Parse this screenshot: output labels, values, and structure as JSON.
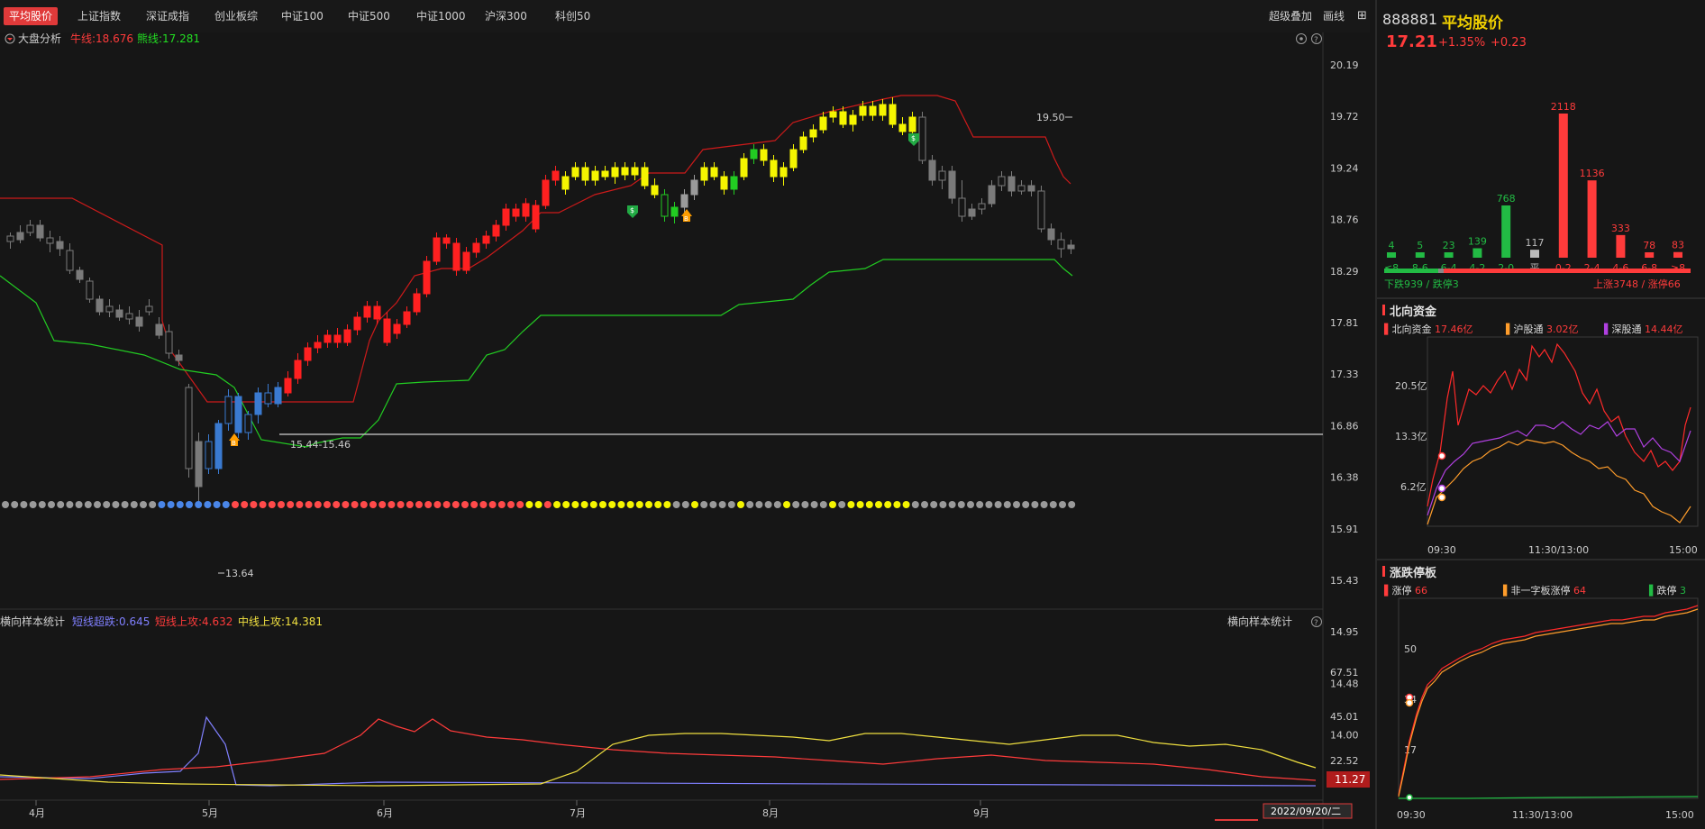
{
  "toolbar": {
    "tabs": [
      "平均股价",
      "上证指数",
      "深证成指",
      "创业板综",
      "中证100",
      "中证500",
      "中证1000",
      "沪深300",
      "科创50"
    ],
    "active_tab": 0,
    "right_actions": [
      "超级叠加",
      "画线"
    ]
  },
  "main_panel": {
    "title": "大盘分析",
    "legend": [
      {
        "label": "牛线:",
        "value": "18.676",
        "color": "#ff3b3b"
      },
      {
        "label": "熊线:",
        "value": "17.281",
        "color": "#22dd22"
      }
    ],
    "price_ticks": [
      "20.19",
      "19.72",
      "19.24",
      "18.76",
      "18.29",
      "17.81",
      "17.33",
      "16.86",
      "16.38",
      "15.91",
      "15.43",
      "14.95",
      "14.48",
      "14.00"
    ],
    "annotations": {
      "high": "19.50",
      "low": "13.64",
      "range": "15.44-15.46"
    },
    "signal_icons": {
      "sell": "$",
      "buy": "B"
    }
  },
  "sub_panel": {
    "title": "横向样本统计",
    "title_right": "横向样本统计",
    "legend": [
      {
        "label": "短线超跌:",
        "value": "0.645",
        "color": "#8080ff"
      },
      {
        "label": "短线上攻:",
        "value": "4.632",
        "color": "#ff3b3b"
      },
      {
        "label": "中线上攻:",
        "value": "14.381",
        "color": "#f0e040"
      }
    ],
    "ticks": [
      "67.51",
      "45.01",
      "22.52"
    ],
    "current_value": "11.27",
    "months": [
      "4月",
      "5月",
      "6月",
      "7月",
      "8月",
      "9月"
    ],
    "date": "2022/09/20/二"
  },
  "quote": {
    "code": "888881",
    "name": "平均股价",
    "price": "17.21",
    "change_pct": "+1.35%",
    "change": "+0.23"
  },
  "distribution": {
    "bins": [
      "≤8",
      "8-6",
      "6-4",
      "4-2",
      "2-0",
      "平",
      "0-2",
      "2-4",
      "4-6",
      "6-8",
      "≥8"
    ],
    "values": [
      4,
      5,
      23,
      139,
      768,
      117,
      2118,
      1136,
      333,
      78,
      83
    ],
    "colors": [
      "#22bb44",
      "#22bb44",
      "#22bb44",
      "#22bb44",
      "#22bb44",
      "#bbbbbb",
      "#ff3b3b",
      "#ff3b3b",
      "#ff3b3b",
      "#ff3b3b",
      "#ff3b3b"
    ],
    "down_text": "下跌939 / 跌停3",
    "up_text": "上涨3748 / 涨停66"
  },
  "north": {
    "title": "北向资金",
    "legend": [
      {
        "label": "北向资金",
        "value": "17.46亿",
        "color": "#ff3b3b"
      },
      {
        "label": "沪股通",
        "value": "3.02亿",
        "color": "#ff9d2b"
      },
      {
        "label": "深股通",
        "value": "14.44亿",
        "color": "#b040e0"
      }
    ],
    "yticks": [
      "20.5亿",
      "13.3亿",
      "6.2亿"
    ],
    "xticks": [
      "09:30",
      "11:30/13:00",
      "15:00"
    ]
  },
  "limit": {
    "title": "涨跌停板",
    "legend": [
      {
        "label": "涨停",
        "value": "66",
        "color": "#ff3b3b"
      },
      {
        "label": "非一字板涨停",
        "value": "64",
        "color": "#ff9d2b"
      },
      {
        "label": "跌停",
        "value": "3",
        "color": "#22bb44"
      }
    ],
    "yticks": [
      "50",
      "34",
      "17"
    ],
    "xticks": [
      "09:30",
      "11:30/13:00",
      "15:00"
    ]
  }
}
